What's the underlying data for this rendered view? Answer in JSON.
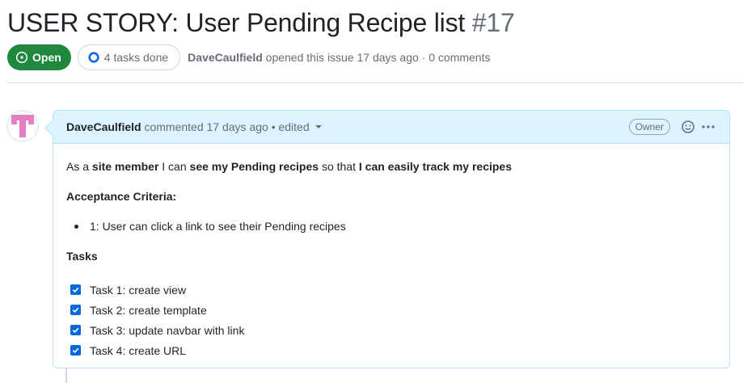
{
  "issue": {
    "title": "USER STORY: User Pending Recipe list",
    "number": "#17",
    "state": "Open",
    "tasks_pill": "4 tasks done",
    "author": "DaveCaulfield",
    "meta": "opened this issue 17 days ago · 0 comments"
  },
  "comment": {
    "author": "DaveCaulfield",
    "meta": "commented 17 days ago • edited",
    "role": "Owner",
    "story": {
      "t1": "As a ",
      "b1": "site member",
      "t2": " I can ",
      "b2": "see my Pending recipes",
      "t3": " so that ",
      "b3": "I can easily track my recipes"
    },
    "criteria_heading": "Acceptance Criteria:",
    "criteria": [
      "1: User can click a link to see their Pending recipes"
    ],
    "tasks_heading": "Tasks",
    "tasks": [
      {
        "label": "Task 1: create view",
        "checked": true
      },
      {
        "label": "Task 2: create template",
        "checked": true
      },
      {
        "label": "Task 3: update navbar with link",
        "checked": true
      },
      {
        "label": "Task 4: create URL",
        "checked": true
      }
    ]
  },
  "colors": {
    "open_green": "#1f883d",
    "accent_blue": "#0969da",
    "comment_header": "#ddf4ff",
    "avatar_pink": "#e47fc1"
  },
  "icons": [
    "issue-opened-icon",
    "progress-ring-icon",
    "caret-down-icon",
    "smiley-icon",
    "kebab-horizontal-icon",
    "checkbox-checked-icon"
  ]
}
